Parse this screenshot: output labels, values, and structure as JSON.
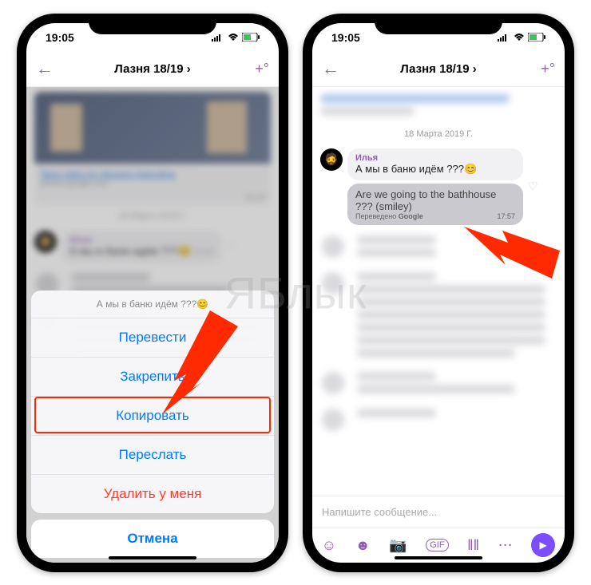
{
  "status": {
    "time": "19:05"
  },
  "header": {
    "title": "Лазня 18/19 ›"
  },
  "link_card": {
    "title": "New video by Aksana Hainulina",
    "subtitle": "photos.google.com",
    "timestamp": "16:18"
  },
  "date_sep": "18 Марта 2019 Г.",
  "message": {
    "author": "Илья",
    "text": "А мы в баню идём ???",
    "emoji": "😊",
    "timestamp": "17:57"
  },
  "translation": {
    "text": "Are we going to the bathhouse ??? (smiley)",
    "provider_prefix": "Переведено",
    "provider": "Google"
  },
  "action_sheet": {
    "context_label": "А мы в баню идём ???",
    "items": [
      "Перевести",
      "Закрепить",
      "Копировать",
      "Переслать"
    ],
    "delete": "Удалить у меня",
    "cancel": "Отмена"
  },
  "input_placeholder": "Напишите сообщение...",
  "watermark": "ЯБлык"
}
